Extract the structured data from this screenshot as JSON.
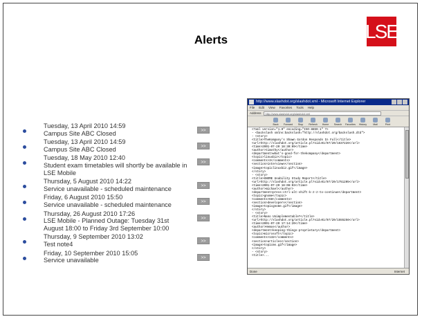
{
  "page": {
    "title": "Alerts",
    "logo_text": "LSE"
  },
  "alerts": [
    {
      "line1": "Tuesday, 13 April 2010 14:59",
      "line2": "Campus Site ABC Closed",
      "button": ">>"
    },
    {
      "line1": "Tuesday, 13 April 2010 14:59",
      "line2": "Campus Site ABC Closed",
      "button": ">>"
    },
    {
      "line1": "Tuesday, 18 May 2010 12:40",
      "line2": "Student exam timetables will shortly be available in LSE Mobile",
      "button": ">>"
    },
    {
      "line1": "Thursday, 5 August 2010 14:22",
      "line2": "Service unavailable - scheduled maintenance",
      "button": ">>"
    },
    {
      "line1": "Friday, 6 August 2010 15:50",
      "line2": "Service unavailable - scheduled maintenance",
      "button": ">>"
    },
    {
      "line1": "Thursday, 26 August 2010 17:26",
      "line2": "LSE Mobile - Planned Outage: Tuesday 31st August 18:00 to Friday 3rd September 10:00",
      "button": ">>"
    },
    {
      "line1": "Thursday, 9 September 2010 13:02",
      "line2": "Test note4",
      "button": ">>"
    },
    {
      "line1": "Friday, 10 September 2010 15:05",
      "line2": "Service unavailable",
      "button": ">>"
    }
  ],
  "browser": {
    "title": "http://www.slashdot.org/slashdot.xml - Microsoft Internet Explorer",
    "menu": [
      "File",
      "Edit",
      "View",
      "Favorites",
      "Tools",
      "Help"
    ],
    "address_label": "Address",
    "address_value": "http://www.slashdot.org/slashdot.xml",
    "toolbar": [
      "Back",
      "Forward",
      "Stop",
      "Refresh",
      "Home",
      "Search",
      "Favorites",
      "History",
      "Mail",
      "Print"
    ],
    "xml_lines": [
      "<?xml version=\"1.0\" encoding=\"ISO-8859-1\" ?>",
      "- <backslash xmlns:backslash=\"http://slashdot.org/backslash.dtd\">",
      "  - <story>",
      "      <title>TheKompany's Shawn Gordon Responds In Full</title>",
      "      <url>http://slashdot.org/article.pl?sid=01/07/20/1637226</url>",
      "      <time>2001-07-20 18:30:09</time>",
      "      <author>timothy</author>",
      "      <department>what's-good-for-thekompany</department>",
      "      <topic>linuxbiz</topic>",
      "      <comments>3</comments>",
      "      <section>interviews</section>",
      "      <image>topiclinuxbiz.gif</image>",
      "    </story>",
      "  - <story>",
      "      <title>GNOME Usability Study Report</title>",
      "      <url>http://slashdot.org/article.pl?sid=01/07/20/1751205</url>",
      "      <time>2001-07-20 18:08:03</time>",
      "      <author>michael</author>",
      "      <department>press-ctrl-alt-shift-k-z-z-to-continue</department>",
      "      <topic>gnome</topic>",
      "      <comments>68</comments>",
      "      <section>developers</section>",
      "      <image>topicgnome.gif</image>",
      "    </story>",
      "  - <story>",
      "      <title>Nano Unimplementable?</title>",
      "      <url>http://slashdot.org/article.pl?sid=01/07/20/1555256</url>",
      "      <time>2001-07-20 17:14:20</time>",
      "      <author>Hemos</author>",
      "      <department>keeping-things-proprietary</department>",
      "      <topic>microsoft</topic>",
      "      <comments>132</comments>",
      "      <section>articles</section>",
      "      <image>topicms.gif</image>",
      "    </story>",
      "  - <story>",
      "      <title>..."
    ],
    "status_left": "Done",
    "status_right": "Internet"
  }
}
